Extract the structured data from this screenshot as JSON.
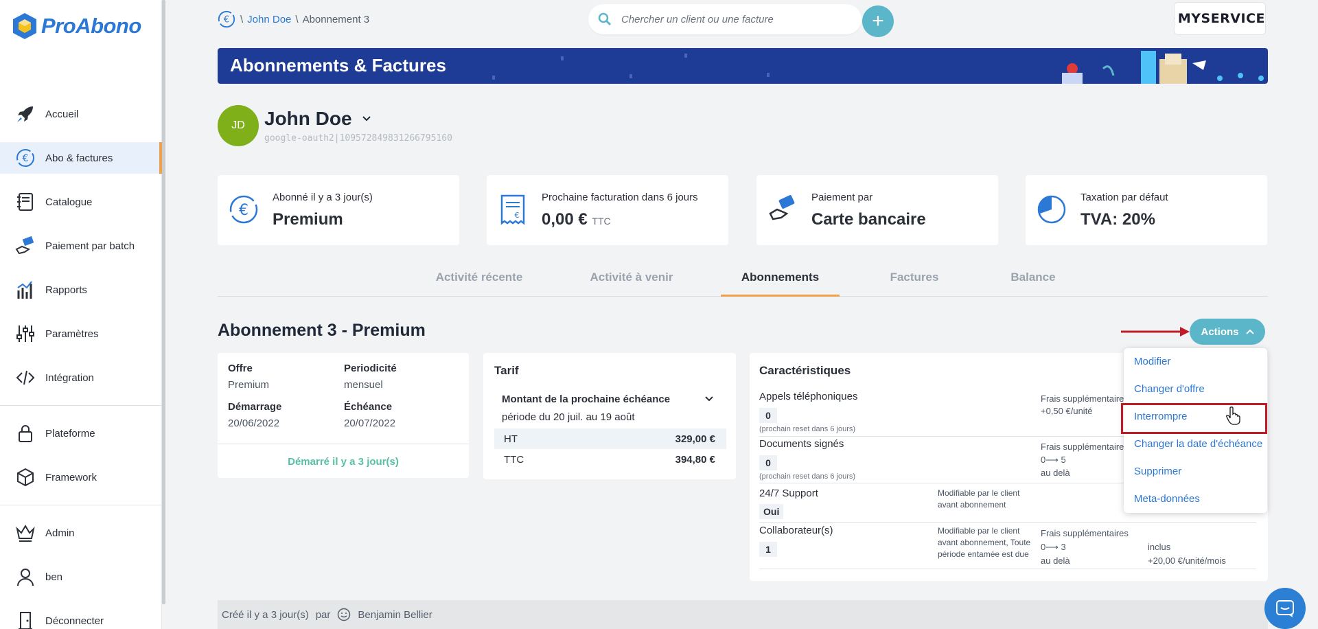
{
  "app": {
    "name": "ProAbono"
  },
  "sidebar": {
    "items": [
      {
        "label": "Accueil",
        "icon": "rocket-icon"
      },
      {
        "label": "Abo & factures",
        "icon": "euro-cycle-icon",
        "active": true
      },
      {
        "label": "Catalogue",
        "icon": "notebook-icon"
      },
      {
        "label": "Paiement par batch",
        "icon": "hand-money-icon"
      },
      {
        "label": "Rapports",
        "icon": "chart-icon"
      },
      {
        "label": "Paramètres",
        "icon": "sliders-icon"
      },
      {
        "label": "Intégration",
        "icon": "code-icon"
      },
      {
        "label": "Plateforme",
        "icon": "lock-icon"
      },
      {
        "label": "Framework",
        "icon": "cube-icon"
      },
      {
        "label": "Admin",
        "icon": "crown-icon"
      },
      {
        "label": "ben",
        "icon": "user-icon"
      },
      {
        "label": "Déconnecter",
        "icon": "door-icon"
      }
    ]
  },
  "breadcrumb": {
    "sep": "\\",
    "customer": "John Doe",
    "current": "Abonnement 3"
  },
  "search": {
    "placeholder": "Chercher un client ou une facture"
  },
  "brand": {
    "name": "MYSERVICE"
  },
  "banner": {
    "title": "Abonnements & Factures"
  },
  "customer": {
    "initials": "JD",
    "name": "John Doe",
    "id": "google-oauth2|109572849831266795160"
  },
  "cards": [
    {
      "label": "Abonné il y a 3 jour(s)",
      "value": "Premium",
      "icon": "euro-cycle-icon"
    },
    {
      "label": "Prochaine facturation dans 6 jours",
      "value": "0,00 €",
      "suffix": "TTC",
      "icon": "receipt-icon"
    },
    {
      "label": "Paiement par",
      "value": "Carte bancaire",
      "icon": "hand-card-icon"
    },
    {
      "label": "Taxation par défaut",
      "value": "TVA: 20%",
      "icon": "pie-icon"
    }
  ],
  "tabs": [
    "Activité récente",
    "Activité à venir",
    "Abonnements",
    "Factures",
    "Balance"
  ],
  "subscription": {
    "title": "Abonnement 3 - Premium",
    "actions_label": "Actions",
    "offer_label": "Offre",
    "offer": "Premium",
    "period_label": "Periodicité",
    "period": "mensuel",
    "start_label": "Démarrage",
    "start": "20/06/2022",
    "end_label": "Échéance",
    "end": "20/07/2022",
    "started": "Démarré il y a 3 jour(s)"
  },
  "tarif": {
    "title": "Tarif",
    "next_label": "Montant de la prochaine échéance",
    "period": "période du 20 juil. au 19 août",
    "ht_label": "HT",
    "ht": "329,00 €",
    "ttc_label": "TTC",
    "ttc": "394,80 €"
  },
  "features": {
    "title": "Caractéristiques",
    "items": [
      {
        "name": "Appels téléphoniques",
        "value": "0",
        "note": "(prochain reset dans 6 jours)",
        "extra_label": "Frais supplémentaires",
        "extra": "+0,50 €/unité"
      },
      {
        "name": "Documents signés",
        "value": "0",
        "note": "(prochain reset dans 6 jours)",
        "extra_label": "Frais supplémentaires",
        "extra": "0⟶ 5",
        "extra2": "au delà"
      },
      {
        "name": "24/7 Support",
        "value": "Oui",
        "mod": "Modifiable par le client avant abonnement"
      },
      {
        "name": "Collaborateur(s)",
        "value": "1",
        "mod": "Modifiable par le client avant abonnement, Toute période entamée est due",
        "extra_label": "Frais supplémentaires",
        "extra": "0⟶ 3",
        "extra2": "au delà",
        "price1": "inclus",
        "price2": "+20,00 €/unité/mois"
      }
    ]
  },
  "dropdown": [
    "Modifier",
    "Changer d'offre",
    "Interrompre",
    "Changer la date d'échéance",
    "Supprimer",
    "Meta-données"
  ],
  "footer": {
    "created": "Créé  il y a 3 jour(s)",
    "by": "par",
    "author": "Benjamin Bellier"
  },
  "colors": {
    "accent": "#5ab6c8",
    "link": "#2b78d6",
    "tab_active": "#f0a04b",
    "banner": "#1e3b95",
    "highlight": "#c01c28"
  }
}
